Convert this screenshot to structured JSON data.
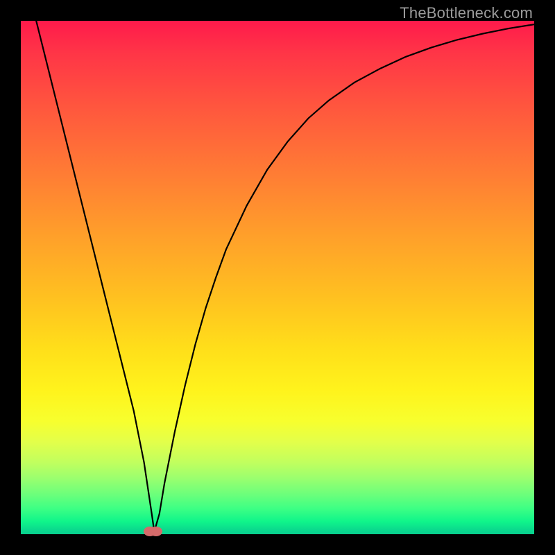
{
  "watermark": "TheBottleneck.com",
  "colors": {
    "frame": "#000000",
    "gradient_top": "#ff1a4b",
    "gradient_bottom": "#08cf8e",
    "curve": "#000000",
    "dot": "#d46a6a",
    "watermark": "#9c9c9c"
  },
  "chart_data": {
    "type": "line",
    "title": "",
    "xlabel": "",
    "ylabel": "",
    "xlim": [
      0,
      100
    ],
    "ylim": [
      0,
      100
    ],
    "annotations": [
      {
        "text": "TheBottleneck.com",
        "position": "top-right"
      }
    ],
    "series": [
      {
        "name": "bottleneck-curve",
        "x": [
          0,
          2,
          4,
          6,
          8,
          10,
          12,
          14,
          16,
          18,
          20,
          22,
          24,
          25.5,
          26,
          27,
          28,
          30,
          32,
          34,
          36,
          38,
          40,
          44,
          48,
          52,
          56,
          60,
          65,
          70,
          75,
          80,
          85,
          90,
          95,
          100
        ],
        "y": [
          112,
          104,
          96,
          88,
          80,
          72,
          64,
          56,
          48,
          40,
          32,
          24,
          14,
          4,
          0.5,
          4,
          10,
          20,
          29,
          37,
          44,
          50,
          55.5,
          64,
          71,
          76.5,
          81,
          84.5,
          88,
          90.7,
          93,
          94.8,
          96.3,
          97.5,
          98.5,
          99.3
        ]
      }
    ],
    "markers": [
      {
        "name": "min-dot-1",
        "x": 25.2,
        "y": 0.6
      },
      {
        "name": "min-dot-2",
        "x": 26.4,
        "y": 0.6
      }
    ]
  }
}
